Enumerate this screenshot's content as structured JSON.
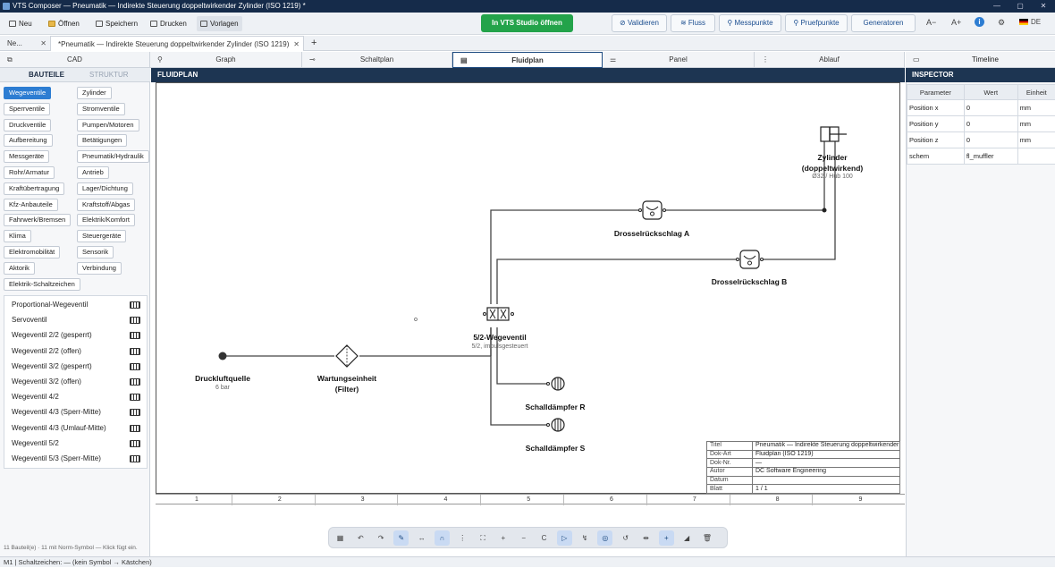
{
  "app": {
    "title": "VTS Composer — Pneumatik — Indirekte Steuerung doppeltwirkender Zylinder (ISO 1219) *",
    "window_controls": [
      "—",
      "▢",
      "✕"
    ]
  },
  "toolbar": {
    "new": "Neu",
    "open": "Öffnen",
    "save": "Speichern",
    "print": "Drucken",
    "templates": "Vorlagen",
    "open_vts_studio": "In VTS Studio öffnen",
    "validate": "Validieren",
    "flow": "Fluss",
    "measure_points": "Messpunkte",
    "test_points": "Pruefpunkte",
    "generators": "Generatoren",
    "font_smaller": "A−",
    "font_larger": "A+",
    "language": "DE"
  },
  "doc_tabs": [
    {
      "label": "Ne...",
      "close": "✕"
    },
    {
      "label": "*Pneumatik — Indirekte Steuerung doppeltwirkender Zylinder (ISO 1219)",
      "close": "✕"
    }
  ],
  "add_tab": "+",
  "view_tabs": [
    "CAD",
    "Graph",
    "Schaltplan",
    "Fluidplan",
    "Panel",
    "Ablauf",
    "Timeline"
  ],
  "left_panel": {
    "tab_parts": "BAUTEILE",
    "tab_structure": "STRUKTUR",
    "categories": [
      "Wegeventile",
      "Zylinder",
      "Sperrventile",
      "Stromventile",
      "Druckventile",
      "Pumpen/Motoren",
      "Aufbereitung",
      "Betätigungen",
      "Messgeräte",
      "Pneumatik/Hydraulik",
      "Rohr/Armatur",
      "Antrieb",
      "Kraftübertragung",
      "Lager/Dichtung",
      "Kfz-Anbauteile",
      "Kraftstoff/Abgas",
      "Fahrwerk/Bremsen",
      "Elektrik/Komfort",
      "Klima",
      "Steuergeräte",
      "Elektromobilität",
      "Sensorik",
      "Aktorik",
      "Verbindung",
      "Elektrik-Schaltzeichen"
    ],
    "active_category": "Wegeventile",
    "parts": [
      "Proportional-Wegeventil",
      "Servoventil",
      "Wegeventil 2/2 (gesperrt)",
      "Wegeventil 2/2 (offen)",
      "Wegeventil 3/2 (gesperrt)",
      "Wegeventil 3/2 (offen)",
      "Wegeventil 4/2",
      "Wegeventil 4/3 (Sperr-Mitte)",
      "Wegeventil 4/3 (Umlauf-Mitte)",
      "Wegeventil 5/2",
      "Wegeventil 5/3 (Sperr-Mitte)"
    ],
    "hint": "11 Bauteil(e) · 11 mit Norm-Symbol — Klick fügt ein."
  },
  "canvas": {
    "header": "FLUIDPLAN",
    "components": {
      "source": {
        "name": "Druckluftquelle",
        "sub": "6 bar"
      },
      "service_unit": {
        "name1": "Wartungseinheit",
        "name2": "(Filter)"
      },
      "valve": {
        "name": "5/2-Wegeventil",
        "sub": "5/2, impulsgesteuert"
      },
      "throttle_a": {
        "name": "Drosselrückschlag A"
      },
      "throttle_b": {
        "name": "Drosselrückschlag B"
      },
      "cylinder": {
        "name1": "Zylinder",
        "name2": "(doppeltwirkend)",
        "sub": "Ø32 / Hub 100"
      },
      "muffler_r": {
        "name": "Schalldämpfer R"
      },
      "muffler_s": {
        "name": "Schalldämpfer S"
      }
    },
    "title_block": [
      {
        "key": "Titel",
        "value": "Pneumatik — Indirekte Steuerung doppeltwirkender Z"
      },
      {
        "key": "Dok-Art",
        "value": "Fluidplan (ISO 1219)"
      },
      {
        "key": "Dok-Nr.",
        "value": "—"
      },
      {
        "key": "Autor",
        "value": "DC Software Engineering"
      },
      {
        "key": "Datum",
        "value": ""
      },
      {
        "key": "Blatt",
        "value": "1 / 1"
      }
    ],
    "ruler": [
      "1",
      "2",
      "3",
      "4",
      "5",
      "6",
      "7",
      "8",
      "9"
    ]
  },
  "canvas_toolbar": {
    "items": [
      "▦",
      "↶",
      "↷",
      "✎",
      "↔",
      "∩",
      "⋮",
      "⛶",
      "+",
      "−",
      "C",
      "▷",
      "↯",
      "◎",
      "↺",
      "⇹",
      "+",
      "◢",
      "🗑"
    ]
  },
  "inspector": {
    "header": "INSPECTOR",
    "columns": [
      "Parameter",
      "Wert",
      "Einheit"
    ],
    "rows": [
      {
        "param": "Position x",
        "value": "0",
        "unit": "mm"
      },
      {
        "param": "Position y",
        "value": "0",
        "unit": "mm"
      },
      {
        "param": "Position z",
        "value": "0",
        "unit": "mm"
      },
      {
        "param": "schem",
        "value": "fl_muffler",
        "unit": ""
      }
    ]
  },
  "status_bar": "M1  |  Schaltzeichen: — (kein Symbol → Kästchen)",
  "colors": {
    "titlebar": "#152b4a",
    "header": "#1d3552",
    "accent_blue": "#2d7dd2",
    "vts_green": "#23a34a"
  }
}
